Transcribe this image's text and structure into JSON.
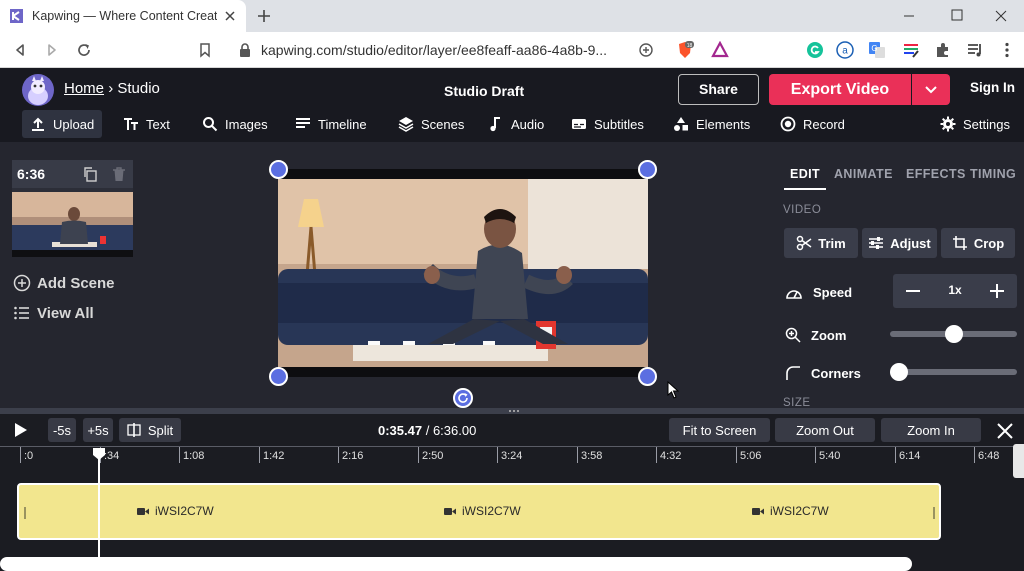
{
  "browser": {
    "tab_title": "Kapwing — Where Content Creators Grow",
    "url": "kapwing.com/studio/editor/layer/ee8feaff-aa86-4a8b-9...",
    "brave_badge": "18"
  },
  "header": {
    "home_label": "Home",
    "separator": "›",
    "studio_label": "Studio",
    "doc_title": "Studio Draft",
    "share_label": "Share",
    "export_label": "Export Video",
    "signin_label": "Sign In"
  },
  "toolbar": {
    "items": [
      {
        "label": "Upload",
        "icon": "upload-icon"
      },
      {
        "label": "Text",
        "icon": "text-icon"
      },
      {
        "label": "Images",
        "icon": "search-icon"
      },
      {
        "label": "Timeline",
        "icon": "timeline-icon"
      },
      {
        "label": "Scenes",
        "icon": "layers-icon"
      },
      {
        "label": "Audio",
        "icon": "music-note-icon"
      },
      {
        "label": "Subtitles",
        "icon": "subtitles-icon"
      },
      {
        "label": "Elements",
        "icon": "shapes-icon"
      },
      {
        "label": "Record",
        "icon": "record-icon"
      },
      {
        "label": "Settings",
        "icon": "gear-icon"
      }
    ]
  },
  "scenes": {
    "duration": "6:36",
    "add_label": "Add Scene",
    "view_all_label": "View All"
  },
  "panel": {
    "tabs": [
      "EDIT",
      "ANIMATE",
      "EFFECTS",
      "TIMING"
    ],
    "active_tab": "EDIT",
    "video_section": "VIDEO",
    "buttons": [
      "Trim",
      "Adjust",
      "Crop"
    ],
    "speed_label": "Speed",
    "speed_value": "1x",
    "zoom_label": "Zoom",
    "zoom_level": 0.5,
    "corners_label": "Corners",
    "corners_level": 0.0,
    "size_section": "SIZE"
  },
  "timeline": {
    "back_label": "-5s",
    "forward_label": "+5s",
    "split_label": "Split",
    "current_time": "0:35.47",
    "total_time": "6:36.00",
    "fit_label": "Fit to Screen",
    "zoom_out_label": "Zoom Out",
    "zoom_in_label": "Zoom In",
    "ticks": [
      ":0",
      ":34",
      "1:08",
      "1:42",
      "2:16",
      "2:50",
      "3:24",
      "3:58",
      "4:32",
      "5:06",
      "5:40",
      "6:14",
      "6:48"
    ],
    "clip_name": "iWSI2C7W",
    "clip_labels": [
      "iWSI2C7W",
      "iWSI2C7W",
      "iWSI2C7W"
    ]
  },
  "colors": {
    "accent": "#ea3058",
    "handle": "#5b6ee1",
    "clip": "#f2e68e"
  }
}
